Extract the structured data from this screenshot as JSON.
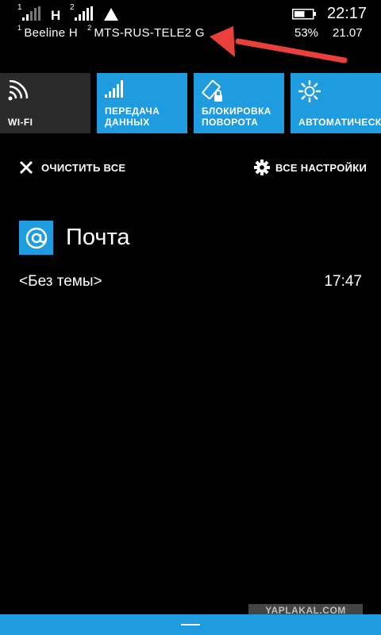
{
  "status_bar": {
    "sim1": {
      "index": "1",
      "network_type": "H",
      "carrier": "Beeline H"
    },
    "sim2": {
      "index": "2",
      "carrier": "MTS-RUS-TELE2 G"
    },
    "time": "22:17",
    "battery_percent": "53%",
    "date": "21.07"
  },
  "quick_actions": [
    {
      "label": "WI-FI",
      "icon": "wifi-icon"
    },
    {
      "label": "ПЕРЕДАЧА\nДАННЫХ",
      "icon": "cellular-data-icon"
    },
    {
      "label": "БЛОКИРОВКА\nПОВОРОТА",
      "icon": "rotation-lock-icon"
    },
    {
      "label": "АВТОМАТИЧЕСКИ",
      "icon": "brightness-icon"
    }
  ],
  "actions": {
    "clear_all": "ОЧИСТИТЬ ВСЕ",
    "all_settings": "ВСЕ НАСТРОЙКИ"
  },
  "notification": {
    "app_name": "Почта",
    "subject": "<Без темы>",
    "time": "17:47"
  },
  "watermark": "YAPLAKAL.COM",
  "colors": {
    "accent": "#1f9be0",
    "arrow": "#e8403a",
    "tile_off": "#2b2b2b"
  }
}
